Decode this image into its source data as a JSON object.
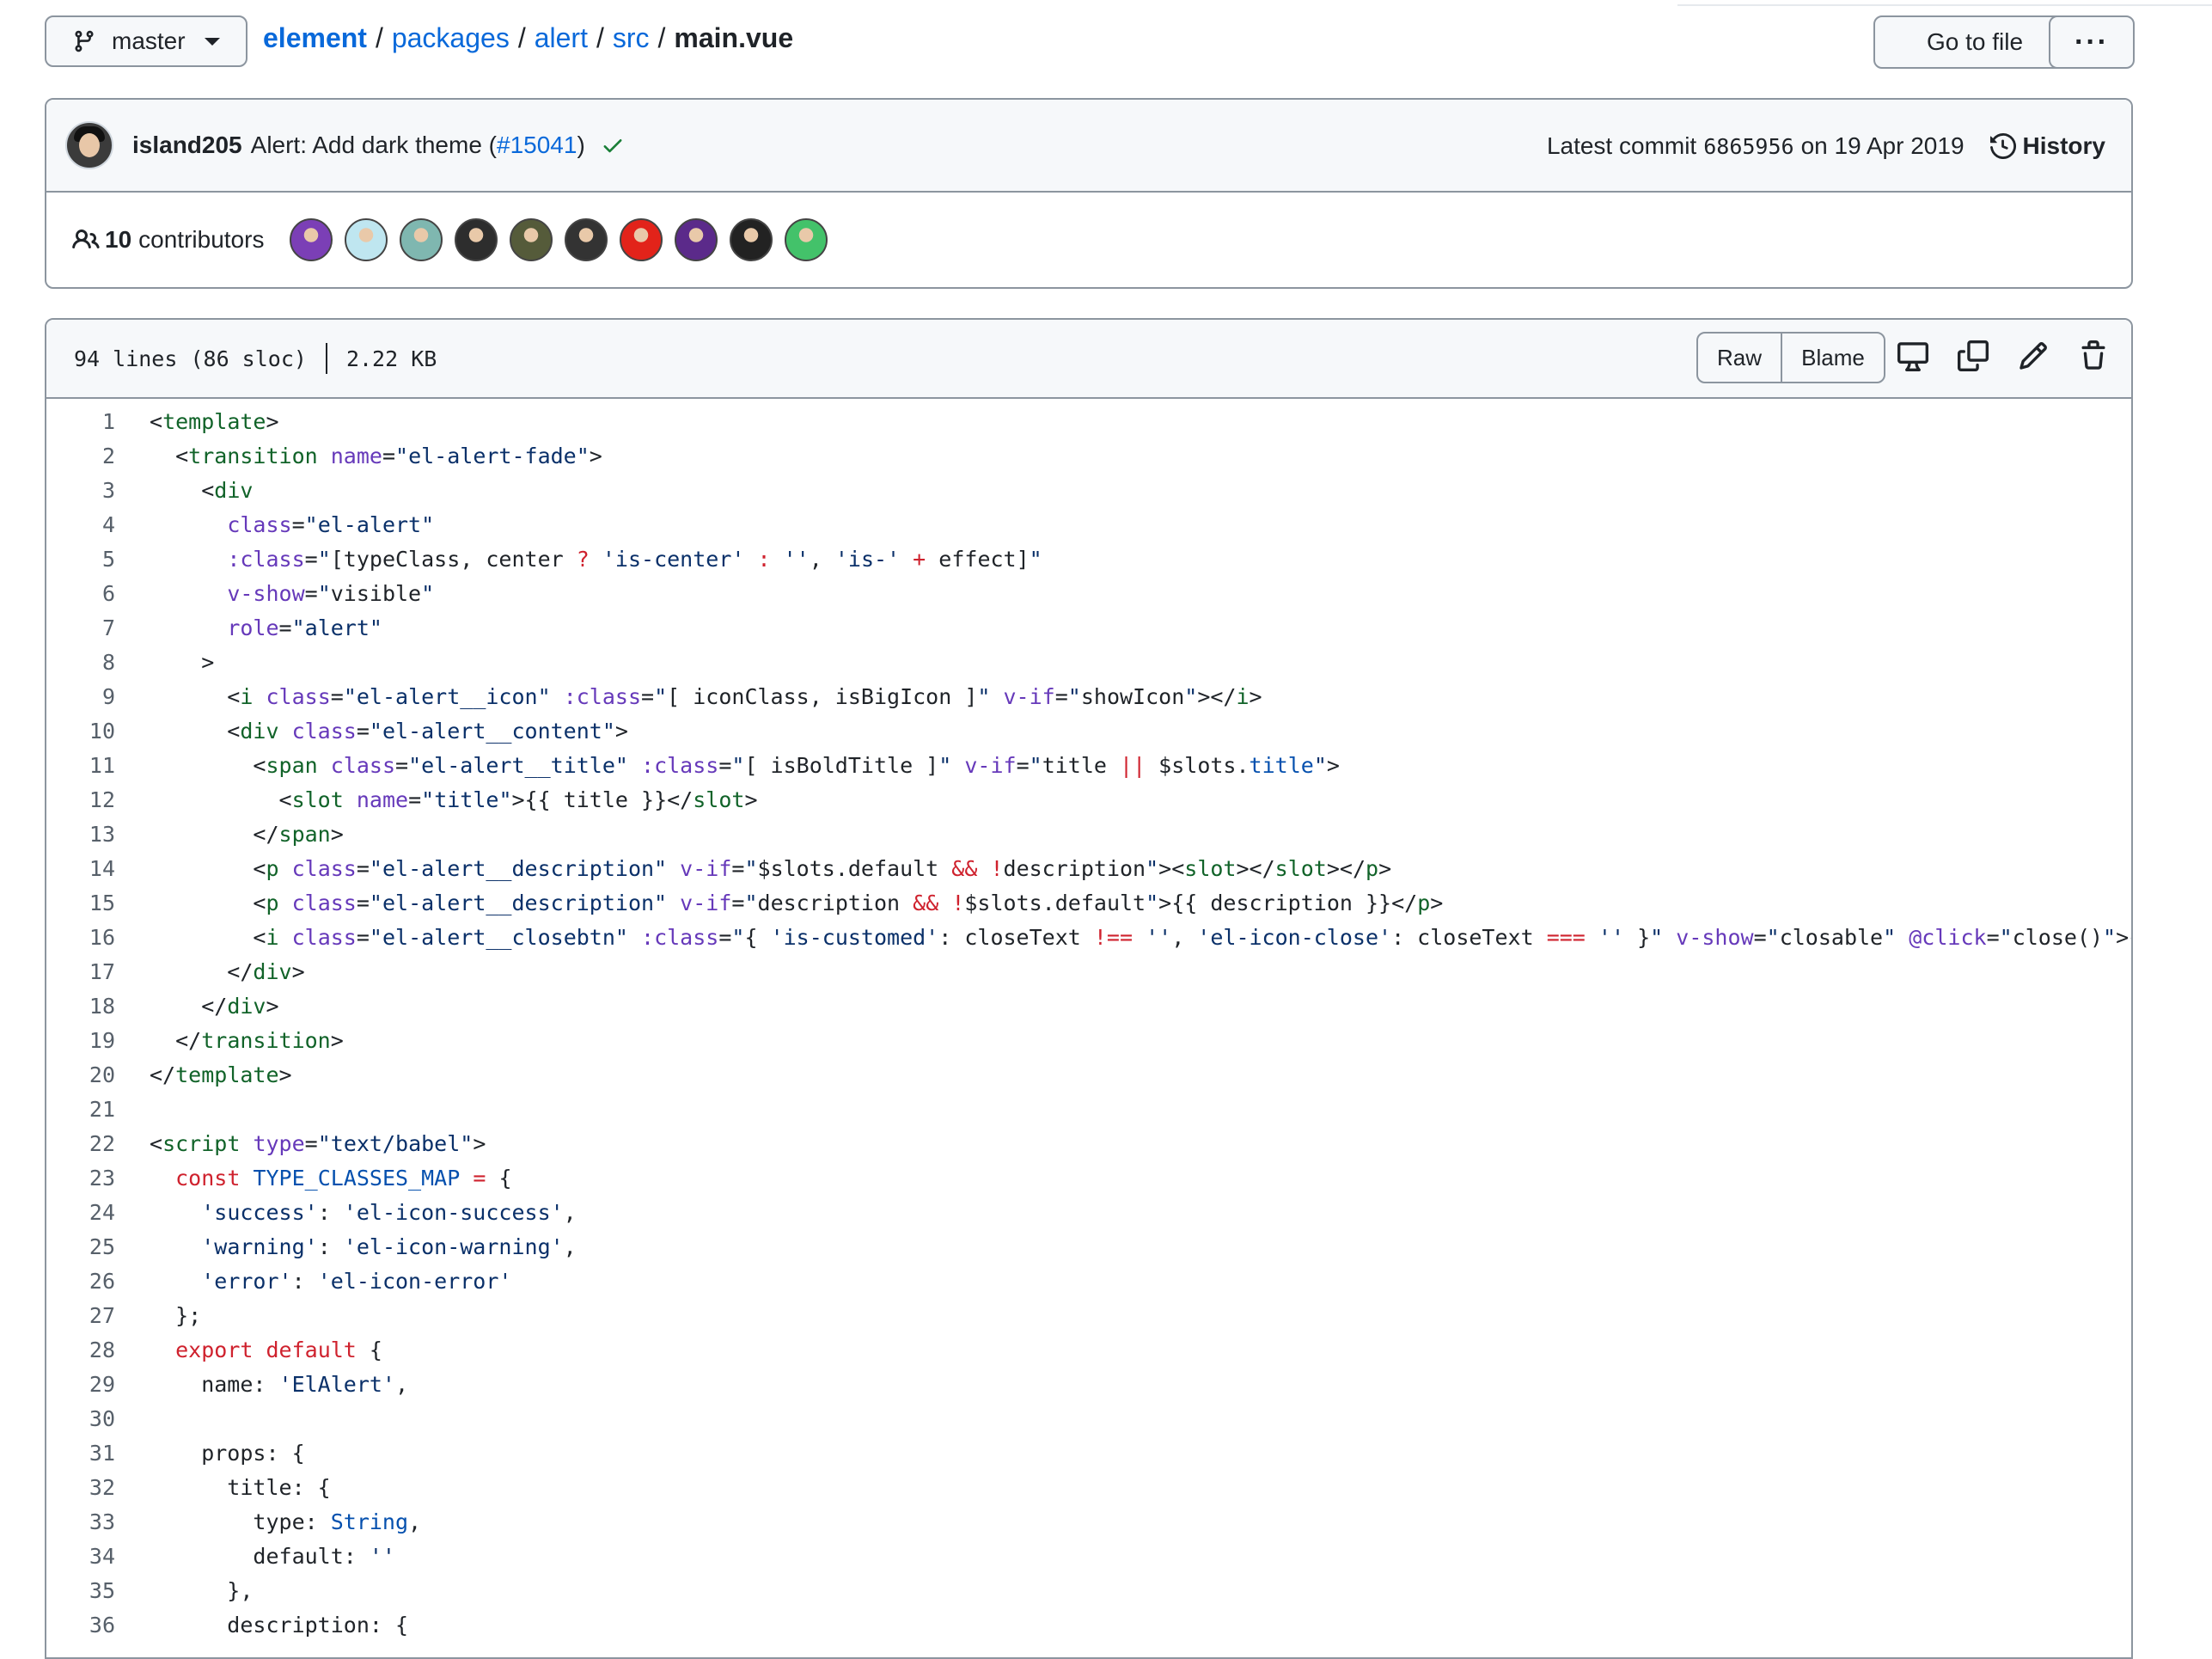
{
  "branch": {
    "name": "master",
    "icon": "git-branch-icon"
  },
  "breadcrumb": {
    "parts": [
      "element",
      "packages",
      "alert",
      "src"
    ],
    "separator": "/",
    "current": "main.vue"
  },
  "actions": {
    "goto_label": "Go to file",
    "more_label": "···"
  },
  "commit": {
    "author": "island205",
    "message_prefix": "Alert: Add dark theme (",
    "pr": "#15041",
    "message_suffix": ")",
    "latest_label": "Latest commit",
    "sha": "6865956",
    "date_text": "on 19 Apr 2019",
    "history_label": "History"
  },
  "contributors": {
    "count": "10",
    "label": "contributors",
    "avatar_colors": [
      "#7b3fb6",
      "#bfe6f0",
      "#7fb7b0",
      "#2d2d2d",
      "#555b3a",
      "#333333",
      "#e2231a",
      "#5b2a8a",
      "#222222",
      "#43c26a"
    ]
  },
  "file": {
    "lines_info": "94 lines (86 sloc)",
    "size": "2.22 KB",
    "raw_label": "Raw",
    "blame_label": "Blame"
  },
  "code_lines": [
    "1",
    "2",
    "3",
    "4",
    "5",
    "6",
    "7",
    "8",
    "9",
    "10",
    "11",
    "12",
    "13",
    "14",
    "15",
    "16",
    "17",
    "18",
    "19",
    "20",
    "21",
    "22",
    "23",
    "24",
    "25",
    "26",
    "27",
    "28",
    "29",
    "30",
    "31",
    "32",
    "33",
    "34",
    "35",
    "36"
  ],
  "colors": {
    "link": "#0969da",
    "tag": "#116329",
    "attr": "#6639ba",
    "string": "#0a3069",
    "keyword": "#cf222e",
    "constant": "#0550ae",
    "success": "#1a7f37"
  }
}
